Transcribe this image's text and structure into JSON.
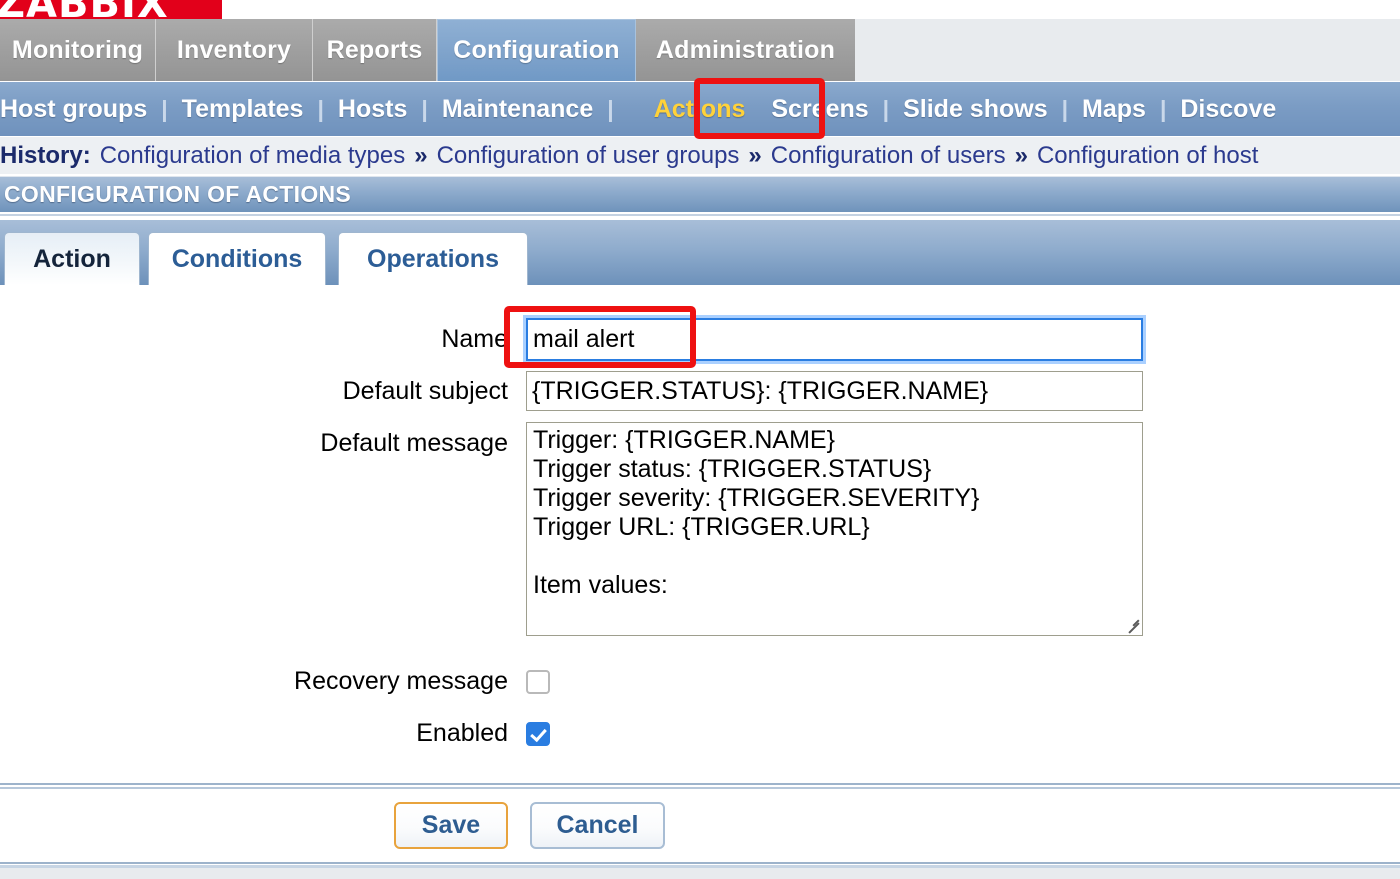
{
  "brand": {
    "logo_text": "ZABBIX",
    "logo_color": "#e2001a"
  },
  "main_menu": {
    "items": [
      {
        "label": "Monitoring",
        "selected": false
      },
      {
        "label": "Inventory",
        "selected": false
      },
      {
        "label": "Reports",
        "selected": false
      },
      {
        "label": "Configuration",
        "selected": true
      },
      {
        "label": "Administration",
        "selected": false
      }
    ]
  },
  "sub_menu": {
    "separator": "|",
    "active_color": "#ffd23a",
    "items": [
      {
        "label": "Host groups",
        "active": false
      },
      {
        "label": "Templates",
        "active": false
      },
      {
        "label": "Hosts",
        "active": false
      },
      {
        "label": "Maintenance",
        "active": false
      },
      {
        "label": "Actions",
        "active": true
      },
      {
        "label": "Screens",
        "active": false
      },
      {
        "label": "Slide shows",
        "active": false
      },
      {
        "label": "Maps",
        "active": false
      },
      {
        "label": "Discove",
        "active": false
      }
    ]
  },
  "history": {
    "label": "History:",
    "separator": "»",
    "items": [
      "Configuration of media types",
      "Configuration of user groups",
      "Configuration of users",
      "Configuration of host"
    ]
  },
  "page": {
    "title": "CONFIGURATION OF ACTIONS"
  },
  "tabs": [
    {
      "label": "Action",
      "active": true
    },
    {
      "label": "Conditions",
      "active": false
    },
    {
      "label": "Operations",
      "active": false
    }
  ],
  "form": {
    "name": {
      "label": "Name",
      "value": "mail alert",
      "focused": true
    },
    "default_subject": {
      "label": "Default subject",
      "value": "{TRIGGER.STATUS}: {TRIGGER.NAME}"
    },
    "default_message": {
      "label": "Default message",
      "value": "Trigger: {TRIGGER.NAME}\nTrigger status: {TRIGGER.STATUS}\nTrigger severity: {TRIGGER.SEVERITY}\nTrigger URL: {TRIGGER.URL}\n\nItem values:\n"
    },
    "recovery_message": {
      "label": "Recovery message",
      "checked": false
    },
    "enabled": {
      "label": "Enabled",
      "checked": true
    }
  },
  "footer": {
    "save_label": "Save",
    "cancel_label": "Cancel"
  },
  "annotations": {
    "color": "#ee1111",
    "boxes": [
      {
        "target": "actions-submenu-item"
      },
      {
        "target": "name-input"
      }
    ]
  }
}
